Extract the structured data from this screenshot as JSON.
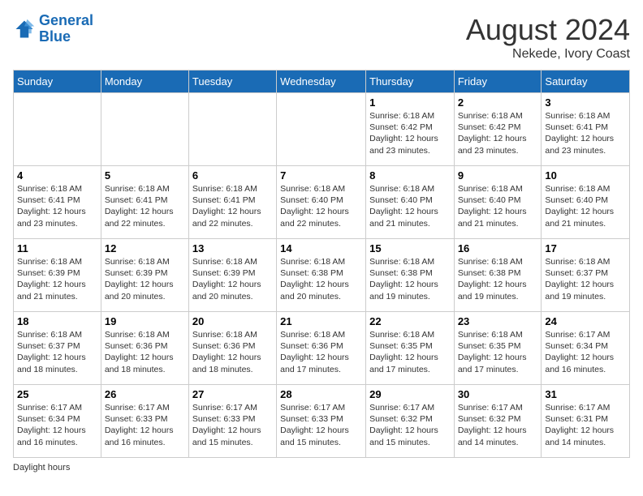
{
  "header": {
    "logo_line1": "General",
    "logo_line2": "Blue",
    "month_year": "August 2024",
    "location": "Nekede, Ivory Coast"
  },
  "days_of_week": [
    "Sunday",
    "Monday",
    "Tuesday",
    "Wednesday",
    "Thursday",
    "Friday",
    "Saturday"
  ],
  "weeks": [
    [
      {
        "day": "",
        "info": ""
      },
      {
        "day": "",
        "info": ""
      },
      {
        "day": "",
        "info": ""
      },
      {
        "day": "",
        "info": ""
      },
      {
        "day": "1",
        "info": "Sunrise: 6:18 AM\nSunset: 6:42 PM\nDaylight: 12 hours\nand 23 minutes."
      },
      {
        "day": "2",
        "info": "Sunrise: 6:18 AM\nSunset: 6:42 PM\nDaylight: 12 hours\nand 23 minutes."
      },
      {
        "day": "3",
        "info": "Sunrise: 6:18 AM\nSunset: 6:41 PM\nDaylight: 12 hours\nand 23 minutes."
      }
    ],
    [
      {
        "day": "4",
        "info": "Sunrise: 6:18 AM\nSunset: 6:41 PM\nDaylight: 12 hours\nand 23 minutes."
      },
      {
        "day": "5",
        "info": "Sunrise: 6:18 AM\nSunset: 6:41 PM\nDaylight: 12 hours\nand 22 minutes."
      },
      {
        "day": "6",
        "info": "Sunrise: 6:18 AM\nSunset: 6:41 PM\nDaylight: 12 hours\nand 22 minutes."
      },
      {
        "day": "7",
        "info": "Sunrise: 6:18 AM\nSunset: 6:40 PM\nDaylight: 12 hours\nand 22 minutes."
      },
      {
        "day": "8",
        "info": "Sunrise: 6:18 AM\nSunset: 6:40 PM\nDaylight: 12 hours\nand 21 minutes."
      },
      {
        "day": "9",
        "info": "Sunrise: 6:18 AM\nSunset: 6:40 PM\nDaylight: 12 hours\nand 21 minutes."
      },
      {
        "day": "10",
        "info": "Sunrise: 6:18 AM\nSunset: 6:40 PM\nDaylight: 12 hours\nand 21 minutes."
      }
    ],
    [
      {
        "day": "11",
        "info": "Sunrise: 6:18 AM\nSunset: 6:39 PM\nDaylight: 12 hours\nand 21 minutes."
      },
      {
        "day": "12",
        "info": "Sunrise: 6:18 AM\nSunset: 6:39 PM\nDaylight: 12 hours\nand 20 minutes."
      },
      {
        "day": "13",
        "info": "Sunrise: 6:18 AM\nSunset: 6:39 PM\nDaylight: 12 hours\nand 20 minutes."
      },
      {
        "day": "14",
        "info": "Sunrise: 6:18 AM\nSunset: 6:38 PM\nDaylight: 12 hours\nand 20 minutes."
      },
      {
        "day": "15",
        "info": "Sunrise: 6:18 AM\nSunset: 6:38 PM\nDaylight: 12 hours\nand 19 minutes."
      },
      {
        "day": "16",
        "info": "Sunrise: 6:18 AM\nSunset: 6:38 PM\nDaylight: 12 hours\nand 19 minutes."
      },
      {
        "day": "17",
        "info": "Sunrise: 6:18 AM\nSunset: 6:37 PM\nDaylight: 12 hours\nand 19 minutes."
      }
    ],
    [
      {
        "day": "18",
        "info": "Sunrise: 6:18 AM\nSunset: 6:37 PM\nDaylight: 12 hours\nand 18 minutes."
      },
      {
        "day": "19",
        "info": "Sunrise: 6:18 AM\nSunset: 6:36 PM\nDaylight: 12 hours\nand 18 minutes."
      },
      {
        "day": "20",
        "info": "Sunrise: 6:18 AM\nSunset: 6:36 PM\nDaylight: 12 hours\nand 18 minutes."
      },
      {
        "day": "21",
        "info": "Sunrise: 6:18 AM\nSunset: 6:36 PM\nDaylight: 12 hours\nand 17 minutes."
      },
      {
        "day": "22",
        "info": "Sunrise: 6:18 AM\nSunset: 6:35 PM\nDaylight: 12 hours\nand 17 minutes."
      },
      {
        "day": "23",
        "info": "Sunrise: 6:18 AM\nSunset: 6:35 PM\nDaylight: 12 hours\nand 17 minutes."
      },
      {
        "day": "24",
        "info": "Sunrise: 6:17 AM\nSunset: 6:34 PM\nDaylight: 12 hours\nand 16 minutes."
      }
    ],
    [
      {
        "day": "25",
        "info": "Sunrise: 6:17 AM\nSunset: 6:34 PM\nDaylight: 12 hours\nand 16 minutes."
      },
      {
        "day": "26",
        "info": "Sunrise: 6:17 AM\nSunset: 6:33 PM\nDaylight: 12 hours\nand 16 minutes."
      },
      {
        "day": "27",
        "info": "Sunrise: 6:17 AM\nSunset: 6:33 PM\nDaylight: 12 hours\nand 15 minutes."
      },
      {
        "day": "28",
        "info": "Sunrise: 6:17 AM\nSunset: 6:33 PM\nDaylight: 12 hours\nand 15 minutes."
      },
      {
        "day": "29",
        "info": "Sunrise: 6:17 AM\nSunset: 6:32 PM\nDaylight: 12 hours\nand 15 minutes."
      },
      {
        "day": "30",
        "info": "Sunrise: 6:17 AM\nSunset: 6:32 PM\nDaylight: 12 hours\nand 14 minutes."
      },
      {
        "day": "31",
        "info": "Sunrise: 6:17 AM\nSunset: 6:31 PM\nDaylight: 12 hours\nand 14 minutes."
      }
    ]
  ],
  "footer": {
    "note": "Daylight hours"
  }
}
